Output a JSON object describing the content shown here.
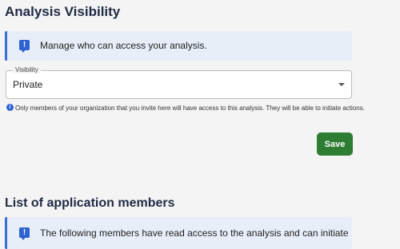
{
  "page": {
    "title": "Analysis Visibility"
  },
  "info_banner": {
    "icon": "message-alert-icon",
    "text": "Manage who can access your analysis."
  },
  "visibility": {
    "label": "Visibility",
    "value": "Private",
    "helper": "Only members of your organization that you invite here will have access to this analysis. They will be able to initiate actions."
  },
  "actions": {
    "save_label": "Save"
  },
  "members": {
    "title": "List of application members",
    "banner_icon": "message-alert-icon",
    "banner_text": "The following members have read access to the analysis and can initiate"
  },
  "colors": {
    "accent": "#3b6fd8",
    "save": "#2e7d32"
  }
}
